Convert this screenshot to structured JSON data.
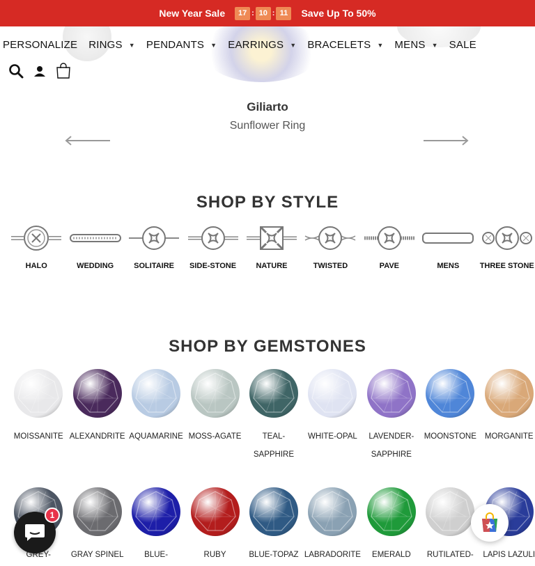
{
  "promo": {
    "title": "New Year Sale",
    "timer": [
      "17",
      "10",
      "11"
    ],
    "timer_sep": ":",
    "save_text": "Save Up To 50%",
    "color": "#d62a24"
  },
  "nav": {
    "items": [
      {
        "label": "PERSONALIZE",
        "has_caret": false
      },
      {
        "label": "RINGS",
        "has_caret": true
      },
      {
        "label": "PENDANTS",
        "has_caret": true
      },
      {
        "label": "EARRINGS",
        "has_caret": true
      },
      {
        "label": "BRACELETS",
        "has_caret": true
      },
      {
        "label": "MENS",
        "has_caret": true
      },
      {
        "label": "SALE",
        "has_caret": false
      }
    ],
    "caret": "▼"
  },
  "header_icons": [
    "search-icon",
    "account-icon",
    "cart-icon"
  ],
  "slide": {
    "brand": "Giliarto",
    "product": "Sunflower Ring"
  },
  "shop_by_style": {
    "title": "SHOP BY STYLE",
    "items": [
      "HALO",
      "WEDDING",
      "SOLITAIRE",
      "SIDE-STONE",
      "NATURE",
      "TWISTED",
      "PAVE",
      "MENS",
      "THREE STONE"
    ]
  },
  "shop_by_gemstones": {
    "title": "SHOP BY GEMSTONES",
    "row1": [
      {
        "label": "MOISSANITE",
        "color": "#e8e8ea"
      },
      {
        "label": "ALEXANDRITE",
        "color": "#4a2a5c"
      },
      {
        "label": "AQUAMARINE",
        "color": "#b8cbe3"
      },
      {
        "label": "MOSS-AGATE",
        "color": "#b9c6c2"
      },
      {
        "label": "TEAL-\nSAPPHIRE",
        "color": "#3f6566"
      },
      {
        "label": "WHITE-OPAL",
        "color": "#dfe3f2"
      },
      {
        "label": "LAVENDER-\nSAPPHIRE",
        "color": "#8f73c7"
      },
      {
        "label": "MOONSTONE",
        "color": "#4f86d8"
      },
      {
        "label": "MORGANITE",
        "color": "#d9a878"
      }
    ],
    "row2": [
      {
        "label": "GREY-",
        "color": "#4c5563"
      },
      {
        "label": "GRAY SPINEL",
        "color": "#6b6b6f"
      },
      {
        "label": "BLUE-",
        "color": "#1d1ea8"
      },
      {
        "label": "RUBY",
        "color": "#b31d1d"
      },
      {
        "label": "BLUE-TOPAZ",
        "color": "#2f5a84"
      },
      {
        "label": "LABRADORITE",
        "color": "#8aa1b3"
      },
      {
        "label": "EMERALD",
        "color": "#1f9a3a"
      },
      {
        "label": "RUTILATED-",
        "color": "#cfcfcf"
      },
      {
        "label": "LAPIS LAZULI",
        "color": "#2a3c9a"
      }
    ]
  },
  "chat": {
    "badge_count": "1"
  }
}
